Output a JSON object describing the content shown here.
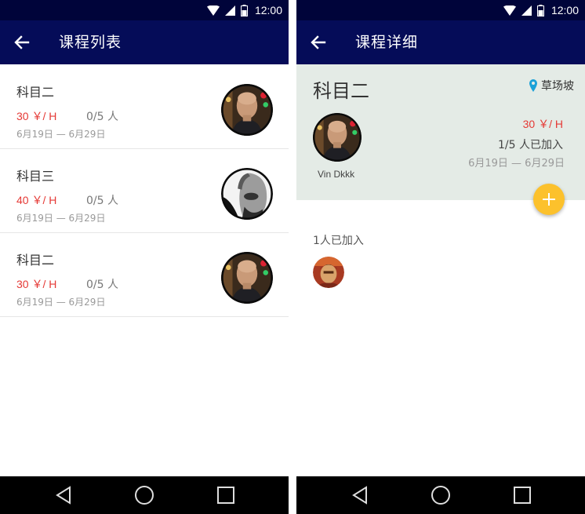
{
  "status": {
    "time": "12:00"
  },
  "list_screen": {
    "title": "课程列表",
    "courses": [
      {
        "name": "科目二",
        "price": "30 ￥/ H",
        "enrollment": "0/5 人",
        "dates": "6月19日 — 6月29日",
        "avatar": "bald-man-avatar"
      },
      {
        "name": "科目三",
        "price": "40 ￥/ H",
        "enrollment": "0/5 人",
        "dates": "6月19日 — 6月29日",
        "avatar": "bw-portrait-avatar"
      },
      {
        "name": "科目二",
        "price": "30 ￥/ H",
        "enrollment": "0/5 人",
        "dates": "6月19日 — 6月29日",
        "avatar": "bald-man-avatar"
      }
    ]
  },
  "detail_screen": {
    "title": "课程详细",
    "course_name": "科目二",
    "location": "草场坡",
    "teacher_name": "Vin Dkkk",
    "price": "30 ￥/ H",
    "enrollment": "1/5  人已加入",
    "dates": "6月19日 — 6月29日",
    "joined_label": "1人已加入",
    "fab_icon": "plus-icon"
  },
  "colors": {
    "status_bar": "#00043a",
    "app_bar": "#050c58",
    "price": "#e53935",
    "detail_header": "#e4ebe6",
    "fab": "#fcc12c",
    "location_pin": "#1ba1d8"
  }
}
